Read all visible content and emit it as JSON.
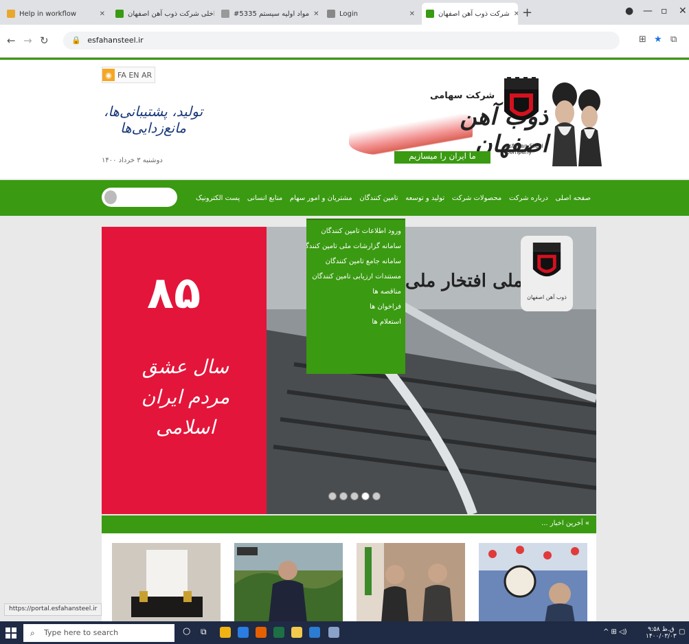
{
  "browser": {
    "tabs": [
      {
        "label": "Help in workflow",
        "active": false,
        "favicon_color": "#e8a830"
      },
      {
        "label": "پورتال داخلی شرکت ذوب آهن اصفهان",
        "active": false,
        "favicon_color": "#3a9a12"
      },
      {
        "label": "#5335 مواد اولیه سیستم",
        "active": false,
        "favicon_color": "#999999"
      },
      {
        "label": "Login",
        "active": false,
        "favicon_color": "#888888"
      },
      {
        "label": "شرکت ذوب آهن اصفهان",
        "active": true,
        "favicon_color": "#3a9a12"
      }
    ],
    "new_tab_label": "+",
    "url": "esfahansteel.ir",
    "status_url": "https://portal.esfahansteel.ir"
  },
  "header": {
    "languages": "FA EN AR",
    "slogan": "تولید، پشتیبانی‌ها، مانع‌زدایی‌ها",
    "date": "دوشنبه ۳ خرداد ۱۴۰۰",
    "company_small": "شرکت سهامی",
    "company_big": "ذوب آهن اصفهان",
    "tagline": "ما ایران را میسازیم",
    "emblem_text": "Esfahan Steel Company"
  },
  "menu": {
    "items": [
      "صفحه اصلی",
      "درباره شرکت",
      "محصولات شرکت",
      "تولید و توسعه",
      "تامین کنندگان",
      "مشتریان و امور سهام",
      "منابع انسانی",
      "پست الکترونیک"
    ],
    "dropdown": [
      "ورود اطلاعات تامین کنندگان",
      "سامانه گزارشات ملی تامین کنندگان",
      "سامانه جامع تامین کنندگان",
      "مستندات ارزیابی تامین کنندگان",
      "مناقصه ها",
      "فراخوان ها",
      "استعلام ها"
    ]
  },
  "slider": {
    "title": "ریل ملی افتخار ملی",
    "logo_text": "ذوب آهن اصفهان",
    "banner_number": "۸۵",
    "banner_caption": "سال عشق مردم ایران اسلامی",
    "dots_count": 5,
    "active_dot": 4
  },
  "news": {
    "title": "» آخرین اخبار ..."
  },
  "taskbar": {
    "search_placeholder": "Type here to search",
    "time": "۹:۵۸ ق.ظ",
    "date": "۱۴۰۰/۰۳/۰۳"
  },
  "colors": {
    "brand_green": "#3a9a12",
    "banner_red": "#e4153a"
  }
}
